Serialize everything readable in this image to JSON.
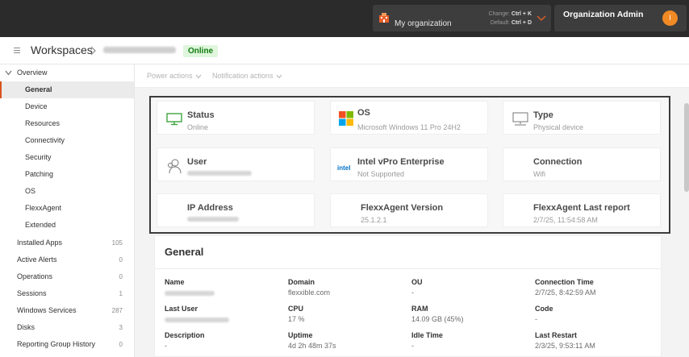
{
  "topbar": {
    "org": {
      "name": "My organization",
      "change_label": "Change:",
      "change_keys": "Ctrl + K",
      "default_label": "Default:",
      "default_keys": "Ctrl + D"
    },
    "admin": {
      "name": "Organization Admin",
      "initial": "I",
      "avatar_color": "#f08a24"
    }
  },
  "header": {
    "breadcrumb_root": "Workspaces",
    "status_badge": "Online"
  },
  "sidebar": {
    "group": "Overview",
    "sub_items": [
      {
        "label": "General",
        "active": true
      },
      {
        "label": "Device"
      },
      {
        "label": "Resources"
      },
      {
        "label": "Connectivity"
      },
      {
        "label": "Security"
      },
      {
        "label": "Patching"
      },
      {
        "label": "OS"
      },
      {
        "label": "FlexxAgent"
      },
      {
        "label": "Extended"
      }
    ],
    "items": [
      {
        "label": "Installed Apps",
        "count": "105"
      },
      {
        "label": "Active Alerts",
        "count": "0"
      },
      {
        "label": "Operations",
        "count": "0"
      },
      {
        "label": "Sessions",
        "count": "1"
      },
      {
        "label": "Windows Services",
        "count": "287"
      },
      {
        "label": "Disks",
        "count": "3"
      },
      {
        "label": "Reporting Group History",
        "count": "0"
      }
    ]
  },
  "actions": {
    "power": "Power actions",
    "notification": "Notification actions"
  },
  "summary": {
    "status": {
      "title": "Status",
      "value": "Online"
    },
    "os": {
      "title": "OS",
      "value": "Microsoft Windows 11 Pro 24H2"
    },
    "type": {
      "title": "Type",
      "value": "Physical device"
    },
    "user": {
      "title": "User"
    },
    "vpro": {
      "title": "Intel vPro Enterprise",
      "value": "Not Supported",
      "logo_text": "intel"
    },
    "connection": {
      "title": "Connection",
      "value": "Wifi"
    },
    "ip": {
      "title": "IP Address"
    },
    "agent_version": {
      "title": "FlexxAgent Version",
      "value": "25.1.2.1"
    },
    "agent_report": {
      "title": "FlexxAgent Last report",
      "value": "2/7/25, 11:54:58 AM"
    }
  },
  "general": {
    "title": "General",
    "fields": {
      "name": {
        "label": "Name"
      },
      "domain": {
        "label": "Domain",
        "value": "flexxible.com"
      },
      "ou": {
        "label": "OU",
        "value": "-"
      },
      "connection_time": {
        "label": "Connection Time",
        "value": "2/7/25, 8:42:59 AM"
      },
      "last_user": {
        "label": "Last User"
      },
      "cpu": {
        "label": "CPU",
        "value": "17 %"
      },
      "ram": {
        "label": "RAM",
        "value": "14.09 GB (45%)"
      },
      "code": {
        "label": "Code",
        "value": "-"
      },
      "description": {
        "label": "Description",
        "value": "-"
      },
      "uptime": {
        "label": "Uptime",
        "value": "4d 2h 48m 37s"
      },
      "idle_time": {
        "label": "Idle Time",
        "value": "-"
      },
      "last_restart": {
        "label": "Last Restart",
        "value": "2/3/25, 9:53:11 AM"
      }
    }
  },
  "colors": {
    "accent": "#d9531e",
    "online_green": "#107c10",
    "topbar": "#2b2b2b"
  }
}
